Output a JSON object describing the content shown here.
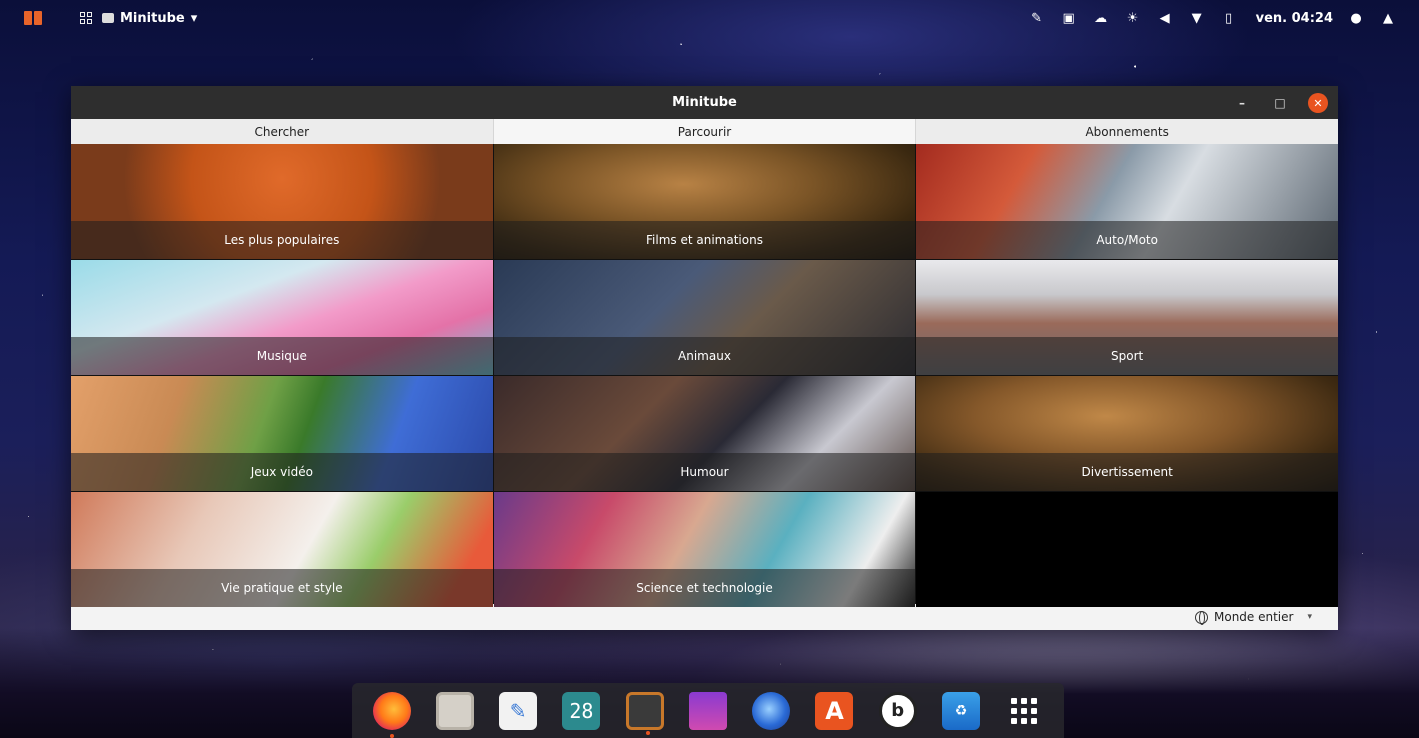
{
  "topbar": {
    "app_name": "Minitube",
    "app_caret": "▾",
    "clock": "ven. 04:24",
    "status_icons": [
      "pen-icon",
      "terminal-icon",
      "cloud-icon",
      "brightness-icon",
      "volume-icon",
      "wifi-icon",
      "clipboard-icon",
      "user-icon",
      "bell-icon"
    ]
  },
  "window": {
    "title": "Minitube",
    "minimize_label": "–",
    "maximize_label": "□",
    "close_label": "✕",
    "tabs": [
      {
        "label": "Chercher"
      },
      {
        "label": "Parcourir"
      },
      {
        "label": "Abonnements"
      }
    ],
    "categories": [
      {
        "label": "Les plus populaires"
      },
      {
        "label": "Films et animations"
      },
      {
        "label": "Auto/Moto"
      },
      {
        "label": "Musique"
      },
      {
        "label": "Animaux"
      },
      {
        "label": "Sport"
      },
      {
        "label": "Jeux vidéo"
      },
      {
        "label": "Humour"
      },
      {
        "label": "Divertissement"
      },
      {
        "label": "Vie pratique et style"
      },
      {
        "label": "Science et technologie"
      }
    ],
    "region": {
      "label": "Monde entier",
      "caret": "▾"
    }
  },
  "dock": {
    "calendar_day": "28",
    "appstore_glyph": "A",
    "b_glyph": "b",
    "trash_glyph": "♻",
    "editor_glyph": "✎"
  },
  "colors": {
    "accent": "#e95420",
    "titlebar": "#2e2e2e",
    "tab_bg": "#ececec"
  }
}
